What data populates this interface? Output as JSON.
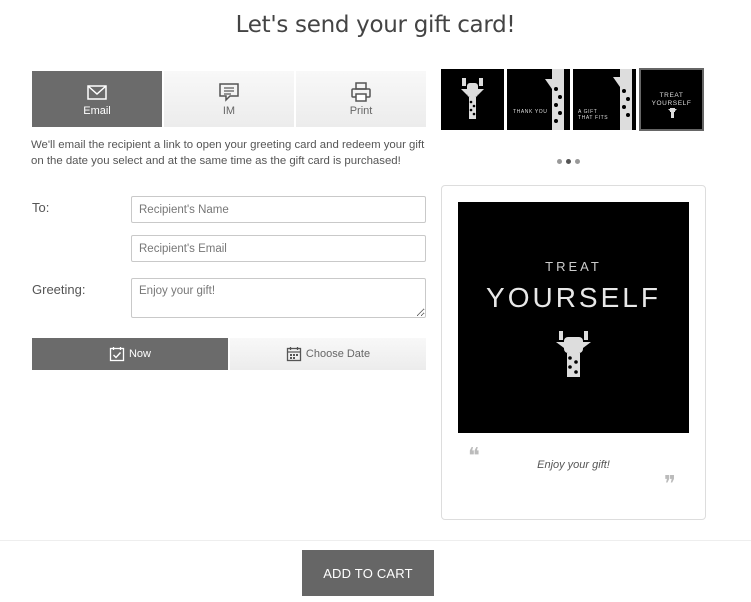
{
  "page": {
    "title": "Let's send your gift card!"
  },
  "delivery": {
    "tabs": [
      {
        "label": "Email",
        "icon": "envelope-icon",
        "active": true
      },
      {
        "label": "IM",
        "icon": "chat-icon",
        "active": false
      },
      {
        "label": "Print",
        "icon": "printer-icon",
        "active": false
      }
    ],
    "description": "We'll email the recipient a link to open your greeting card and redeem your gift on the date you select and at the same time as the gift card is purchased!"
  },
  "form": {
    "to_label": "To:",
    "name_placeholder": "Recipient's Name",
    "email_placeholder": "Recipient's Email",
    "greeting_label": "Greeting:",
    "greeting_placeholder": "Enjoy your gift!",
    "now_label": "Now",
    "choose_date_label": "Choose Date"
  },
  "designs": {
    "thumbnails": [
      {
        "text": "",
        "selected": false
      },
      {
        "text": "THANK YOU",
        "selected": false
      },
      {
        "text": "A GIFT THAT FITS",
        "selected": false
      },
      {
        "text": "TREAT YOURSELF",
        "selected": true
      }
    ],
    "pages": 3,
    "current_page": 2
  },
  "preview": {
    "line1": "TREAT",
    "line2": "YOURSELF",
    "greeting": "Enjoy your gift!"
  },
  "footer": {
    "add_to_cart": "ADD TO CART"
  },
  "colors": {
    "active": "#6b6b6b",
    "button": "#666666"
  }
}
